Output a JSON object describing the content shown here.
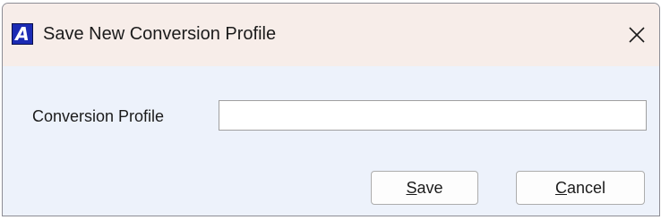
{
  "window": {
    "title": "Save New Conversion Profile",
    "app_icon_letter": "A",
    "app_icon_name": "app-logo-icon",
    "close_icon_name": "close-icon"
  },
  "form": {
    "profile_label": "Conversion Profile",
    "profile_value": ""
  },
  "buttons": {
    "save_mnemonic": "S",
    "save_rest": "ave",
    "cancel_mnemonic": "C",
    "cancel_rest": "ancel"
  },
  "colors": {
    "titlebar": "#f7ede9",
    "body": "#edf2fb",
    "icon_blue": "#1b2bb4"
  }
}
